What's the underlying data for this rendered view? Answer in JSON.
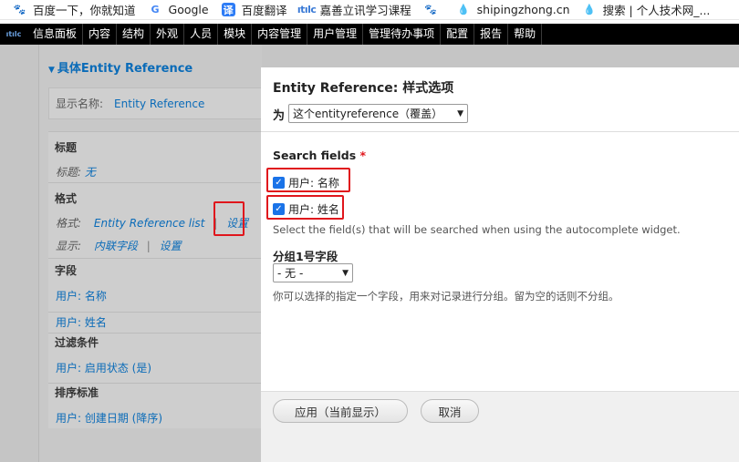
{
  "bookmarks": [
    {
      "icon": "paw-icon",
      "label": "百度一下，你就知道"
    },
    {
      "icon": "google-icon",
      "label": "Google"
    },
    {
      "icon": "translate-icon",
      "label": "百度翻译"
    },
    {
      "icon": "jsl-icon",
      "label": "嘉善立讯学习课程"
    },
    {
      "icon": "paw-icon",
      "label": ""
    },
    {
      "icon": "drop-icon",
      "label": "shipingzhong.cn"
    },
    {
      "icon": "drop-icon",
      "label": "搜索 | 个人技术网_..."
    }
  ],
  "toolbar": {
    "items": [
      "信息面板",
      "内容",
      "结构",
      "外观",
      "人员",
      "模块",
      "内容管理",
      "用户管理",
      "管理待办事项",
      "配置",
      "报告",
      "帮助"
    ]
  },
  "left": {
    "section_title": "具体Entity Reference",
    "display_name_label": "显示名称:",
    "display_name_value": "Entity Reference",
    "title_group": "标题",
    "title_label": "标题:",
    "title_value": "无",
    "format_group": "格式",
    "format_label": "格式:",
    "format_value": "Entity Reference list",
    "format_settings": "设置",
    "show_label": "显示:",
    "show_value": "内联字段",
    "show_settings": "设置",
    "fields_group": "字段",
    "field1": "用户: 名称",
    "field2": "用户: 姓名",
    "filter_group": "过滤条件",
    "filter1": "用户: 启用状态 (是)",
    "sort_group": "排序标准",
    "sort1": "用户: 创建日期 (降序)"
  },
  "modal": {
    "title": "Entity Reference: 样式选项",
    "for_label": "为",
    "for_select": "这个entityreference（覆盖）",
    "search_fields_label": "Search fields",
    "required_mark": "*",
    "checkbox1": "用户: 名称",
    "checkbox2": "用户: 姓名",
    "search_help": "Select the field(s) that will be searched when using the autocomplete widget.",
    "grouping_label": "分组1号字段",
    "grouping_select": "- 无 -",
    "grouping_help": "你可以选择的指定一个字段，用来对记录进行分组。留为空的话则不分组。",
    "apply_button": "应用（当前显示）",
    "cancel_button": "取消"
  },
  "colors": {
    "accent": "#0a6bb8",
    "highlight": "#e0161c",
    "checkbox": "#1a73e8"
  }
}
